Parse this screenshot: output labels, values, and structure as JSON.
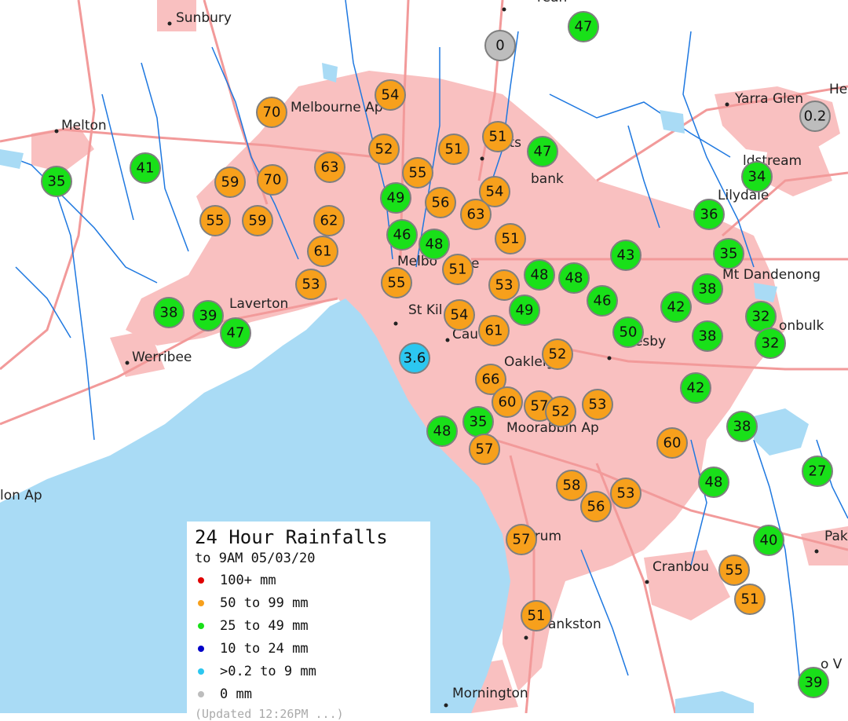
{
  "legend": {
    "title": "24 Hour Rainfalls",
    "subtitle": "to 9AM 05/03/20",
    "items": [
      {
        "label": "100+ mm",
        "color": "#e00000"
      },
      {
        "label": "50  to 99 mm",
        "color": "#f7a01c"
      },
      {
        "label": "25  to 49 mm",
        "color": "#19e019"
      },
      {
        "label": "10  to 24 mm",
        "color": "#0000c8"
      },
      {
        "label": ">0.2 to 9 mm",
        "color": "#2cc7f0"
      },
      {
        "label": "0 mm",
        "color": "#bdbdbd"
      }
    ],
    "updated": "(Updated 12:26PM ...)"
  },
  "colors": {
    "water": "#a9dbf5",
    "urban": "#f9c0c0",
    "land": "#ffffff",
    "rivers": "#1e78e0",
    "roads": "#f29a9a",
    "orange": "#f7a01c",
    "green": "#19e019",
    "cyan": "#2cc7f0",
    "grey": "#bdbdbd"
  },
  "places": [
    "Sunbury",
    "Melton",
    "Melbourne Ap",
    "Laverton",
    "Werribee",
    "lon Ap",
    "Melbo",
    "e",
    "St Kil",
    "Cau",
    "Oakleig",
    "cresby",
    "Moorabbin Ap",
    "le",
    "Yarra Glen",
    "He",
    "ldstream",
    "Lilydale",
    "Mt Dandenong",
    "onbulk",
    "rrum",
    "Cranbou",
    "ankston",
    "Mornington",
    "Pak",
    "o V",
    "ats",
    "bank",
    "rean"
  ],
  "stations": [
    {
      "value": "35",
      "cat": "green"
    },
    {
      "value": "41",
      "cat": "green"
    },
    {
      "value": "70",
      "cat": "orange"
    },
    {
      "value": "59",
      "cat": "orange"
    },
    {
      "value": "70",
      "cat": "orange"
    },
    {
      "value": "55",
      "cat": "orange"
    },
    {
      "value": "59",
      "cat": "orange"
    },
    {
      "value": "63",
      "cat": "orange"
    },
    {
      "value": "62",
      "cat": "orange"
    },
    {
      "value": "61",
      "cat": "orange"
    },
    {
      "value": "53",
      "cat": "orange"
    },
    {
      "value": "38",
      "cat": "green"
    },
    {
      "value": "39",
      "cat": "green"
    },
    {
      "value": "47",
      "cat": "green"
    },
    {
      "value": "54",
      "cat": "orange"
    },
    {
      "value": "52",
      "cat": "orange"
    },
    {
      "value": "51",
      "cat": "orange"
    },
    {
      "value": "51",
      "cat": "orange"
    },
    {
      "value": "47",
      "cat": "green"
    },
    {
      "value": "55",
      "cat": "orange"
    },
    {
      "value": "49",
      "cat": "green"
    },
    {
      "value": "56",
      "cat": "orange"
    },
    {
      "value": "54",
      "cat": "orange"
    },
    {
      "value": "63",
      "cat": "orange"
    },
    {
      "value": "46",
      "cat": "green"
    },
    {
      "value": "48",
      "cat": "green"
    },
    {
      "value": "51",
      "cat": "orange"
    },
    {
      "value": "51",
      "cat": "orange"
    },
    {
      "value": "55",
      "cat": "orange"
    },
    {
      "value": "53",
      "cat": "orange"
    },
    {
      "value": "48",
      "cat": "green"
    },
    {
      "value": "48",
      "cat": "green"
    },
    {
      "value": "54",
      "cat": "orange"
    },
    {
      "value": "49",
      "cat": "green"
    },
    {
      "value": "61",
      "cat": "orange"
    },
    {
      "value": "46",
      "cat": "green"
    },
    {
      "value": "50",
      "cat": "green"
    },
    {
      "value": "52",
      "cat": "orange"
    },
    {
      "value": "3.6",
      "cat": "cyan"
    },
    {
      "value": "66",
      "cat": "orange"
    },
    {
      "value": "60",
      "cat": "orange"
    },
    {
      "value": "57",
      "cat": "orange"
    },
    {
      "value": "53",
      "cat": "orange"
    },
    {
      "value": "52",
      "cat": "orange"
    },
    {
      "value": "35",
      "cat": "green"
    },
    {
      "value": "48",
      "cat": "green"
    },
    {
      "value": "57",
      "cat": "orange"
    },
    {
      "value": "43",
      "cat": "green"
    },
    {
      "value": "36",
      "cat": "green"
    },
    {
      "value": "35",
      "cat": "green"
    },
    {
      "value": "38",
      "cat": "green"
    },
    {
      "value": "42",
      "cat": "green"
    },
    {
      "value": "38",
      "cat": "green"
    },
    {
      "value": "32",
      "cat": "green"
    },
    {
      "value": "32",
      "cat": "green"
    },
    {
      "value": "42",
      "cat": "green"
    },
    {
      "value": "38",
      "cat": "green"
    },
    {
      "value": "60",
      "cat": "orange"
    },
    {
      "value": "48",
      "cat": "green"
    },
    {
      "value": "27",
      "cat": "green"
    },
    {
      "value": "58",
      "cat": "orange"
    },
    {
      "value": "56",
      "cat": "orange"
    },
    {
      "value": "53",
      "cat": "orange"
    },
    {
      "value": "57",
      "cat": "orange"
    },
    {
      "value": "40",
      "cat": "green"
    },
    {
      "value": "55",
      "cat": "orange"
    },
    {
      "value": "51",
      "cat": "orange"
    },
    {
      "value": "51",
      "cat": "orange"
    },
    {
      "value": "39",
      "cat": "green"
    },
    {
      "value": "34",
      "cat": "green"
    },
    {
      "value": "47",
      "cat": "green"
    },
    {
      "value": "0",
      "cat": "grey"
    },
    {
      "value": "0.2",
      "cat": "grey"
    }
  ]
}
